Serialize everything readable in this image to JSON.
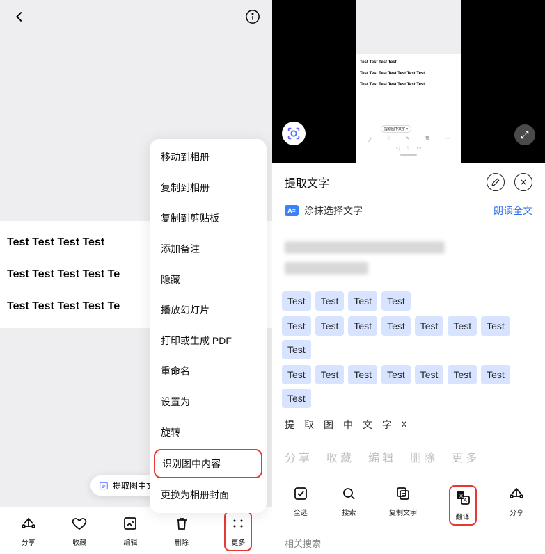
{
  "left": {
    "image_lines": [
      "Test Test Test Test",
      "Test Test Test Test Te",
      "Test Test Test Test Te"
    ],
    "chip": "提取图中文",
    "menu": [
      {
        "label": "移动到相册",
        "hl": false
      },
      {
        "label": "复制到相册",
        "hl": false
      },
      {
        "label": "复制到剪贴板",
        "hl": false
      },
      {
        "label": "添加备注",
        "hl": false
      },
      {
        "label": "隐藏",
        "hl": false
      },
      {
        "label": "播放幻灯片",
        "hl": false
      },
      {
        "label": "打印或生成 PDF",
        "hl": false
      },
      {
        "label": "重命名",
        "hl": false
      },
      {
        "label": "设置为",
        "hl": false
      },
      {
        "label": "旋转",
        "hl": false
      },
      {
        "label": "识别图中内容",
        "hl": true
      },
      {
        "label": "更换为相册封面",
        "hl": false
      }
    ],
    "bottom": [
      {
        "label": "分享",
        "icon": "share",
        "hl": false
      },
      {
        "label": "收藏",
        "icon": "heart",
        "hl": false
      },
      {
        "label": "编辑",
        "icon": "edit",
        "hl": false
      },
      {
        "label": "删除",
        "icon": "trash",
        "hl": false
      },
      {
        "label": "更多",
        "icon": "more",
        "hl": true
      }
    ]
  },
  "right": {
    "preview_lines": [
      "Test Test Test Test",
      "Test Test Test Test Test Test Test",
      "Test Test Test Test Test Test Test"
    ],
    "preview_chip": "提取图中文字 ×",
    "sheet": {
      "title": "提取文字",
      "select_label": "涂抹选择文字",
      "read_all": "朗读全文",
      "tokens_row1": [
        "Test",
        "Test",
        "Test",
        "Test"
      ],
      "tokens_row2": [
        "Test",
        "Test",
        "Test",
        "Test",
        "Test",
        "Test",
        "Test",
        "Test"
      ],
      "tokens_row3": [
        "Test",
        "Test",
        "Test",
        "Test",
        "Test",
        "Test",
        "Test",
        "Test"
      ],
      "plain_tokens": [
        "提",
        "取",
        "图",
        "中",
        "文",
        "字",
        "x"
      ],
      "gray_actions": [
        "分享",
        "收藏",
        "编辑",
        "删除",
        "更多"
      ],
      "actions": [
        {
          "label": "全选",
          "icon": "select-all",
          "hl": false
        },
        {
          "label": "搜索",
          "icon": "search",
          "hl": false
        },
        {
          "label": "复制文字",
          "icon": "copy",
          "hl": false
        },
        {
          "label": "翻译",
          "icon": "translate",
          "hl": true
        },
        {
          "label": "分享",
          "icon": "share",
          "hl": false
        }
      ],
      "footer": "相关搜索"
    }
  }
}
